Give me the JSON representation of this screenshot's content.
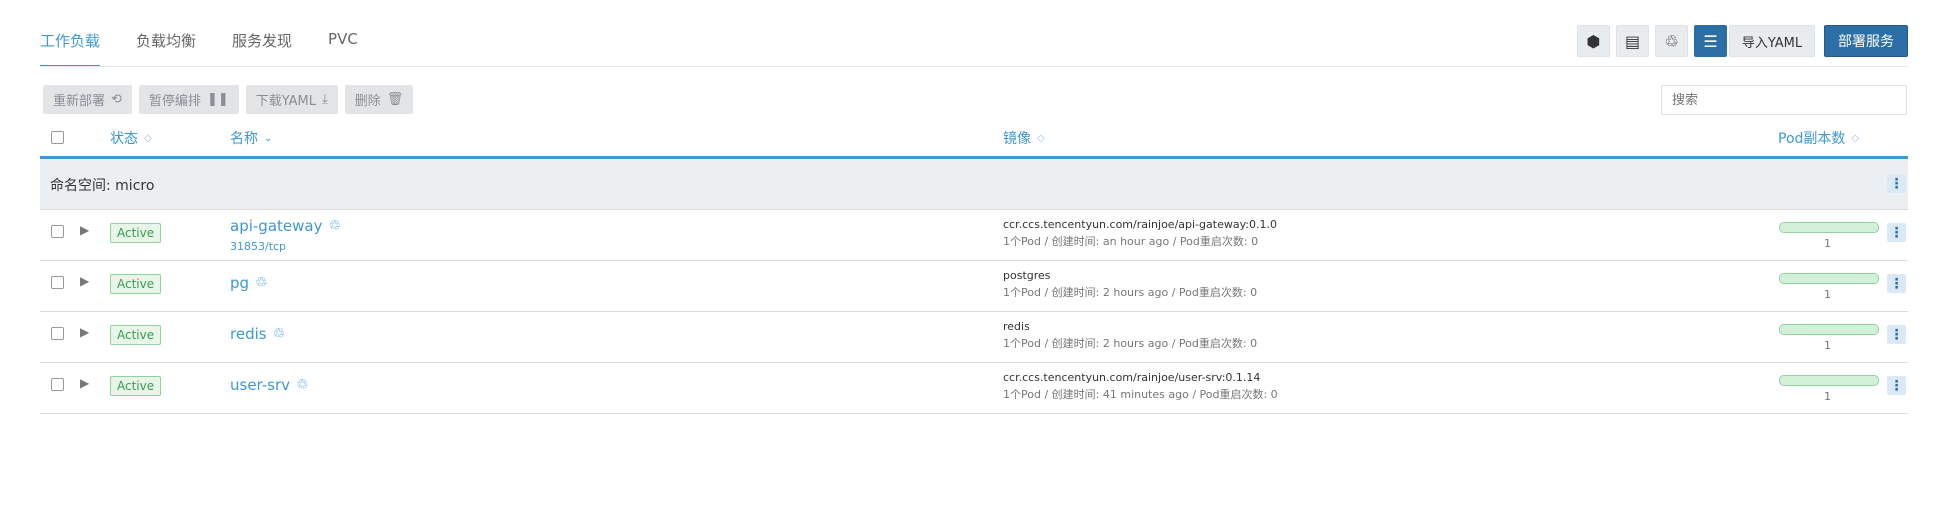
{
  "tabs": [
    {
      "label": "工作负载",
      "active": true
    },
    {
      "label": "负载均衡",
      "active": false
    },
    {
      "label": "服务发现",
      "active": false
    },
    {
      "label": "PVC",
      "active": false
    }
  ],
  "view_buttons": [
    {
      "icon": "hexagon-icon",
      "glyph": "⬢"
    },
    {
      "icon": "list-icon",
      "glyph": "▤"
    },
    {
      "icon": "balancer-icon",
      "glyph": "♲"
    },
    {
      "icon": "tree-icon",
      "glyph": "☰"
    }
  ],
  "toolbar": {
    "import_label": "导入YAML",
    "deploy_label": "部署服务"
  },
  "actions": [
    {
      "label": "重新部署",
      "icon": "redeploy-icon",
      "glyph": "⟲"
    },
    {
      "label": "暂停编排",
      "icon": "pause-icon",
      "glyph": "❚❚"
    },
    {
      "label": "下载YAML",
      "icon": "download-icon",
      "glyph": "⤓"
    },
    {
      "label": "删除",
      "icon": "trash-icon",
      "glyph": "🗑"
    }
  ],
  "search": {
    "placeholder": "搜索"
  },
  "columns": {
    "state": "状态",
    "name": "名称",
    "image": "镜像",
    "replicas": "Pod副本数"
  },
  "group": {
    "label": "命名空间: micro"
  },
  "rows": [
    {
      "state": "Active",
      "name": "api-gateway",
      "port": "31853/tcp",
      "image": "ccr.ccs.tencentyun.com/rainjoe/api-gateway:0.1.0",
      "meta": "1个Pod / 创建时间: an hour ago / Pod重启次数: 0",
      "replicas": "1",
      "replica_fraction": 1
    },
    {
      "state": "Active",
      "name": "pg",
      "port": "",
      "image": "postgres",
      "meta": "1个Pod / 创建时间: 2 hours ago / Pod重启次数: 0",
      "replicas": "1",
      "replica_fraction": 1
    },
    {
      "state": "Active",
      "name": "redis",
      "port": "",
      "image": "redis",
      "meta": "1个Pod / 创建时间: 2 hours ago / Pod重启次数: 0",
      "replicas": "1",
      "replica_fraction": 1
    },
    {
      "state": "Active",
      "name": "user-srv",
      "port": "",
      "image": "ccr.ccs.tencentyun.com/rainjoe/user-srv:0.1.14",
      "meta": "1个Pod / 创建时间: 41 minutes ago / Pod重启次数: 0",
      "replicas": "1",
      "replica_fraction": 1
    }
  ],
  "colors": {
    "accent": "#3d98d3",
    "primary_button": "#2c6ea6",
    "active_badge": "#3a9b51"
  }
}
